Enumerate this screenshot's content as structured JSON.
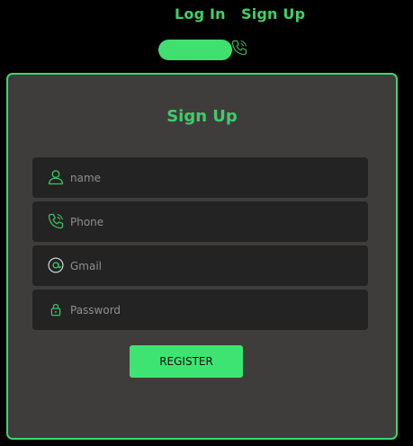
{
  "nav": {
    "login_label": "Log In",
    "signup_label": "Sign Up"
  },
  "form": {
    "title": "Sign Up",
    "fields": [
      {
        "icon": "user-icon",
        "placeholder": "name",
        "value": ""
      },
      {
        "icon": "phone-icon",
        "placeholder": "Phone",
        "value": ""
      },
      {
        "icon": "at-icon",
        "placeholder": "Gmail",
        "value": ""
      },
      {
        "icon": "lock-icon",
        "placeholder": "Password",
        "value": ""
      }
    ],
    "register_label": "REGISTER"
  },
  "colors": {
    "accent": "#40e070",
    "card_bg": "#3e3d3b",
    "field_bg": "#232323",
    "page_bg": "#000000"
  }
}
